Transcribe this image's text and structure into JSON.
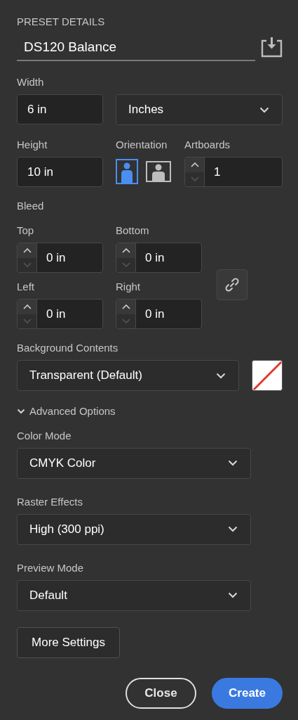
{
  "section_title": "PRESET DETAILS",
  "preset_name": {
    "value": "DS120 Balance"
  },
  "width": {
    "label": "Width",
    "value": "6 in"
  },
  "units": {
    "value": "Inches"
  },
  "height": {
    "label": "Height",
    "value": "10 in"
  },
  "orientation": {
    "label": "Orientation",
    "options": [
      {
        "kind": "portrait",
        "selected": true
      },
      {
        "kind": "landscape",
        "selected": false
      }
    ]
  },
  "artboards": {
    "label": "Artboards",
    "value": "1"
  },
  "bleed": {
    "label": "Bleed",
    "fields": [
      {
        "label": "Top",
        "value": "0 in"
      },
      {
        "label": "Bottom",
        "value": "0 in"
      },
      {
        "label": "Left",
        "value": "0 in"
      },
      {
        "label": "Right",
        "value": "0 in"
      }
    ]
  },
  "background_contents": {
    "label": "Background Contents",
    "value": "Transparent (Default)"
  },
  "advanced_options": {
    "label": "Advanced Options",
    "expanded": true
  },
  "advanced_selects": [
    {
      "label": "Color Mode",
      "value": "CMYK Color"
    },
    {
      "label": "Raster Effects",
      "value": "High (300 ppi)"
    },
    {
      "label": "Preview Mode",
      "value": "Default"
    }
  ],
  "more_settings": "More Settings",
  "buttons": [
    {
      "label": "Close",
      "kind": "secondary"
    },
    {
      "label": "Create",
      "kind": "primary"
    }
  ]
}
